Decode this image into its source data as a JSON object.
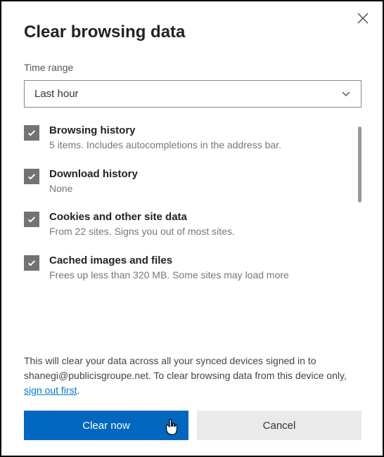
{
  "dialog": {
    "title": "Clear browsing data",
    "close_aria": "Close"
  },
  "time_range": {
    "label": "Time range",
    "selected": "Last hour"
  },
  "options": [
    {
      "title": "Browsing history",
      "desc": "5 items. Includes autocompletions in the address bar."
    },
    {
      "title": "Download history",
      "desc": "None"
    },
    {
      "title": "Cookies and other site data",
      "desc": "From 22 sites. Signs you out of most sites."
    },
    {
      "title": "Cached images and files",
      "desc": "Frees up less than 320 MB. Some sites may load more"
    }
  ],
  "footer": {
    "text_before": "This will clear your data across all your synced devices signed in to shanegi@publicisgroupe.net. To clear browsing data from this device only, ",
    "link": "sign out first",
    "text_after": "."
  },
  "buttons": {
    "primary": "Clear now",
    "secondary": "Cancel"
  }
}
